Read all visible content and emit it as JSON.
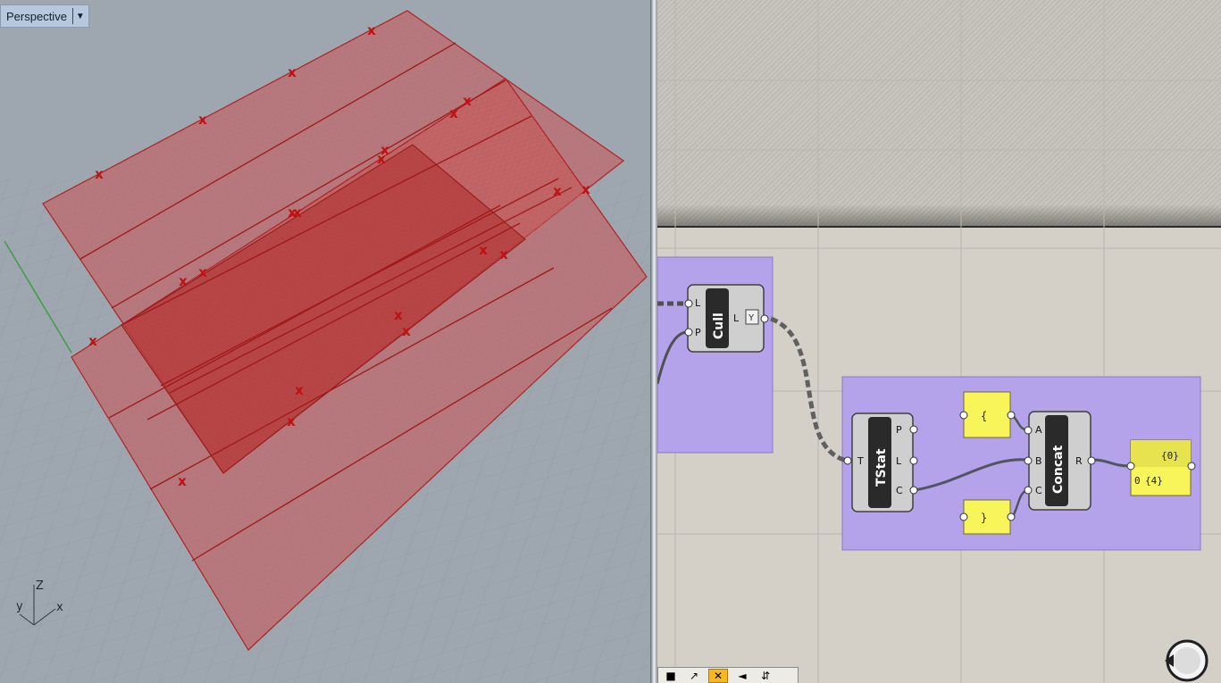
{
  "viewport": {
    "label": "Perspective",
    "axes": {
      "z": "Z",
      "y": "y",
      "x": "x"
    }
  },
  "canvas": {
    "cull": {
      "title": "Cull",
      "in": [
        "L",
        "P"
      ],
      "out": [
        "L"
      ]
    },
    "tstat": {
      "title": "TStat",
      "in": [
        "T"
      ],
      "out": [
        "P",
        "L",
        "C"
      ]
    },
    "concat": {
      "title": "Concat",
      "in": [
        "A",
        "B",
        "C"
      ],
      "out": [
        "R"
      ]
    },
    "panel_open": "{",
    "panel_close": "}",
    "result_panel": {
      "path": "{0}",
      "index": "0",
      "value": "{4}"
    }
  },
  "colors": {
    "group": "#b4a2ea",
    "panel": "#f8f55a",
    "surface": "#c84c4c",
    "mark": "#c01010"
  }
}
